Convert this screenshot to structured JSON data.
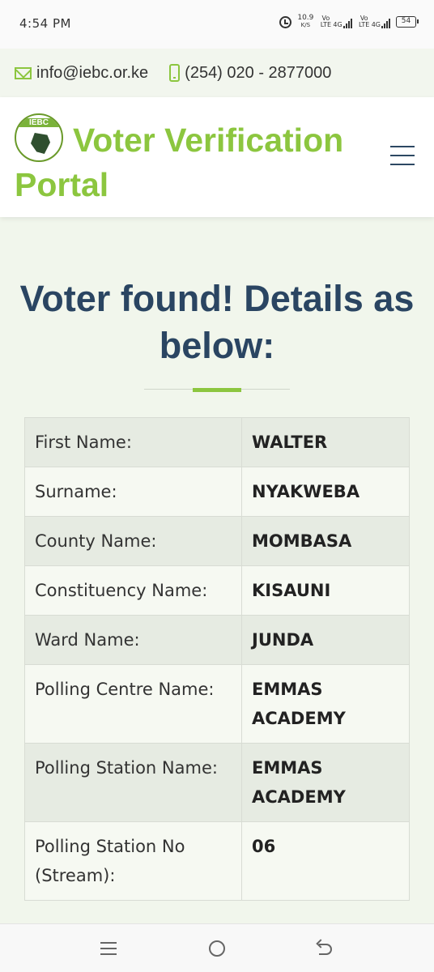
{
  "status_bar": {
    "time": "4:54 PM",
    "speed_value": "10.9",
    "speed_unit": "K/S",
    "sim1_label": "Vo LTE",
    "sim1_network": "4G",
    "sim2_label": "Vo LTE",
    "sim2_network": "4G",
    "battery": "54"
  },
  "contact": {
    "email": "info@iebc.or.ke",
    "phone": "(254) 020 - 2877000"
  },
  "header": {
    "logo_text": "IEBC",
    "title": "Voter Verification Portal"
  },
  "main": {
    "heading": "Voter found! Details as below:"
  },
  "details": [
    {
      "label": "First Name:",
      "value": "WALTER"
    },
    {
      "label": "Surname:",
      "value": "NYAKWEBA"
    },
    {
      "label": "County Name:",
      "value": "MOMBASA"
    },
    {
      "label": "Constituency Name:",
      "value": "KISAUNI"
    },
    {
      "label": "Ward Name:",
      "value": "JUNDA"
    },
    {
      "label": "Polling Centre Name:",
      "value": "EMMAS ACADEMY"
    },
    {
      "label": "Polling Station Name:",
      "value": "EMMAS ACADEMY"
    },
    {
      "label": "Polling Station No (Stream):",
      "value": "06"
    }
  ],
  "colors": {
    "accent_green": "#8cc63f",
    "heading_navy": "#2a4562",
    "page_bg": "#f1f6ec"
  }
}
